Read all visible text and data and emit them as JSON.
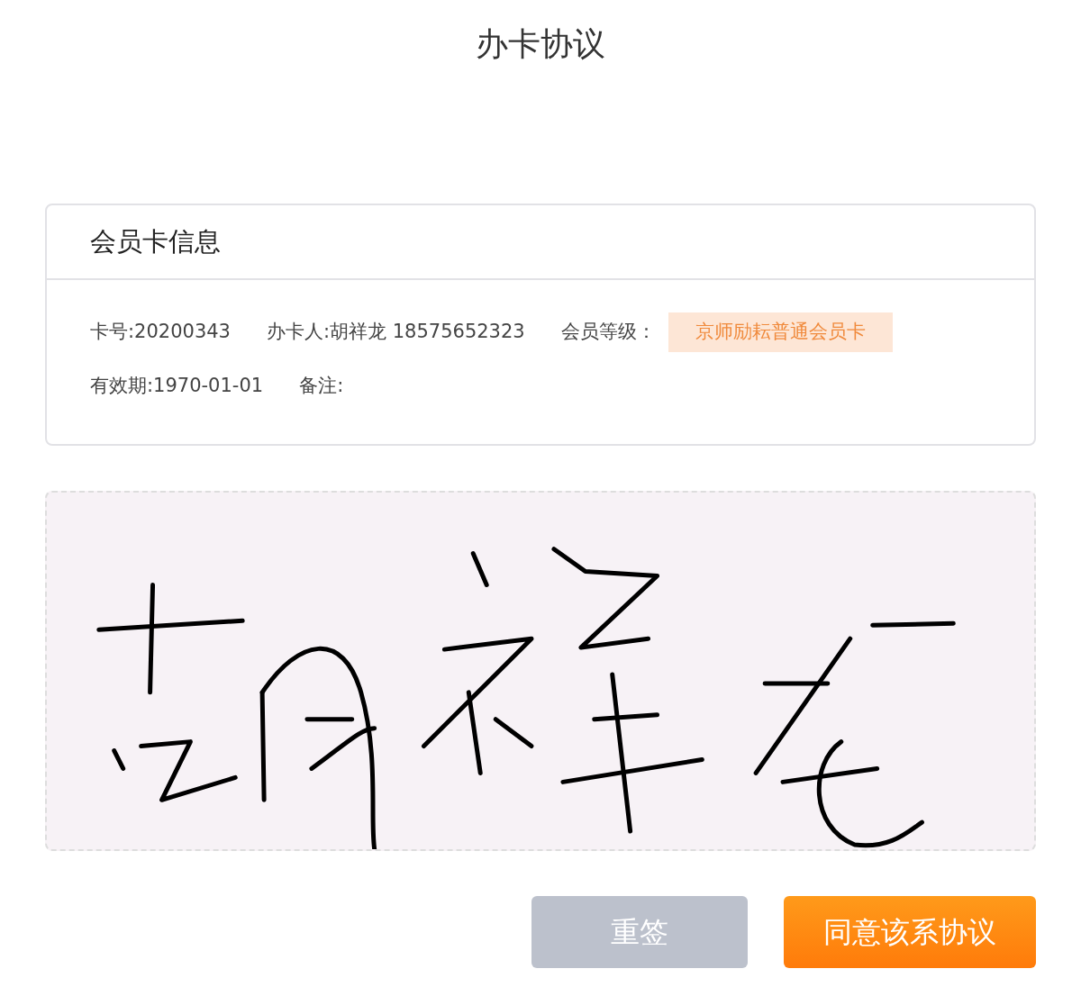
{
  "title": "办卡协议",
  "card": {
    "title": "会员卡信息",
    "rows": [
      {
        "items": [
          {
            "kind": "plain",
            "text": "卡号:20200343"
          },
          {
            "kind": "plain",
            "text": "办卡人:胡祥龙 18575652323"
          },
          {
            "kind": "plain",
            "text": "会员等级："
          },
          {
            "kind": "badge",
            "text": "京师励耘普通会员卡"
          }
        ]
      },
      {
        "items": [
          {
            "kind": "plain",
            "text": "有效期:1970-01-01"
          },
          {
            "kind": "plain",
            "text": "备注:"
          }
        ]
      }
    ]
  },
  "buttons": [
    {
      "kind": "secondary",
      "label": "重签"
    },
    {
      "kind": "primary",
      "label": "同意该系协议"
    }
  ]
}
